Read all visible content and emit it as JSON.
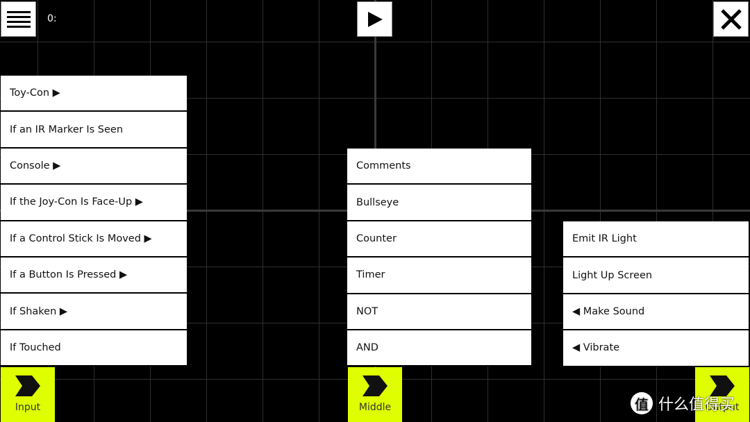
{
  "header": {
    "counter": "0:",
    "menu_icon": "hamburger-icon",
    "play_icon": "play-icon",
    "close_icon": "close-icon"
  },
  "input_menu": {
    "items": [
      "Toy-Con ▶",
      "If an IR Marker Is Seen",
      "Console ▶",
      "If the Joy-Con Is Face-Up ▶",
      "If a Control Stick Is Moved ▶",
      "If a Button Is Pressed ▶",
      "If Shaken ▶",
      "If Touched"
    ]
  },
  "middle_menu": {
    "items": [
      "Comments",
      "Bullseye",
      "Counter",
      "Timer",
      "NOT",
      "AND"
    ]
  },
  "output_menu": {
    "items": [
      "Emit IR Light",
      "Light Up Screen",
      "◀ Make Sound",
      "◀ Vibrate"
    ]
  },
  "categories": {
    "input": "Input",
    "middle": "Middle",
    "output": "Output"
  },
  "colors": {
    "accent": "#dfff00",
    "background": "#000000"
  },
  "watermark": {
    "badge": "值",
    "text": "什么值得买"
  }
}
